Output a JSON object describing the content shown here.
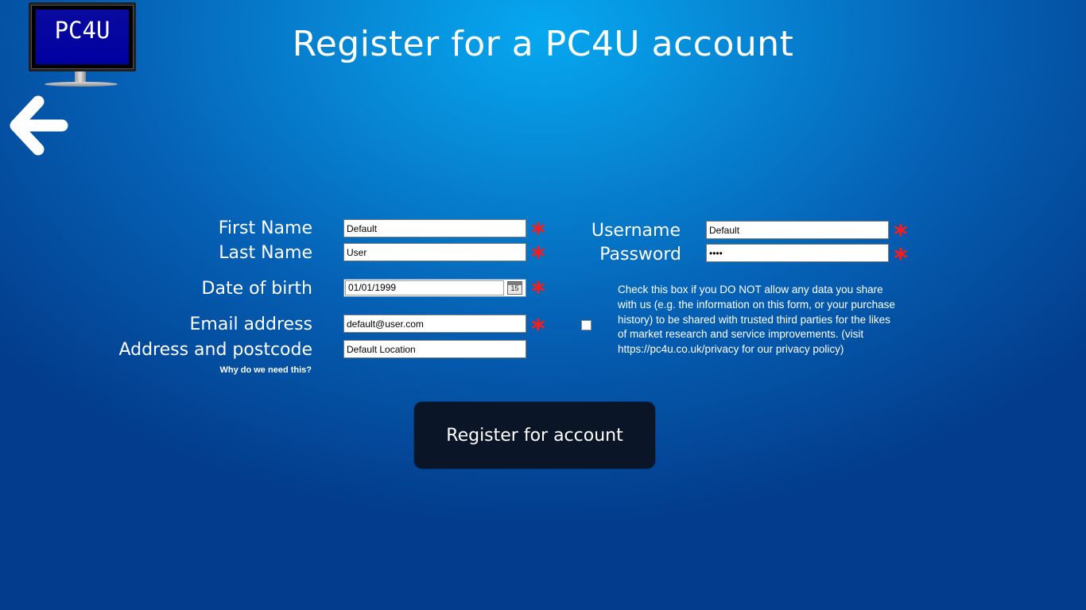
{
  "logo": {
    "text": "PC4U"
  },
  "header": {
    "title": "Register for a PC4U account"
  },
  "form": {
    "first_name": {
      "label": "First Name",
      "value": "Default"
    },
    "last_name": {
      "label": "Last Name",
      "value": "User"
    },
    "dob": {
      "label": "Date of birth",
      "value": "01/01/1999",
      "calendar_day": "15"
    },
    "email": {
      "label": "Email address",
      "value": "default@user.com"
    },
    "address": {
      "label": "Address and postcode",
      "value": "Default Location"
    },
    "why_link": "Why do we need this?",
    "username": {
      "label": "Username",
      "value": "Default"
    },
    "password": {
      "label": "Password",
      "value": "••••"
    },
    "required_marker": "*",
    "consent_text": "Check this box if you DO NOT allow any data you share with us (e.g. the information on this form, or your purchase history) to be shared with trusted third parties for the likes of market research and service improvements. (visit https://pc4u.co.uk/privacy for our privacy policy)",
    "consent_checked": false
  },
  "actions": {
    "register_label": "Register for account"
  },
  "colors": {
    "background_center": "#06a8f0",
    "background_edge": "#033c8c",
    "required": "#ff1a1a",
    "button_bg": "#0a1628"
  },
  "icons": {
    "back": "left-arrow-icon",
    "calendar": "calendar-icon",
    "logo": "monitor-icon"
  }
}
